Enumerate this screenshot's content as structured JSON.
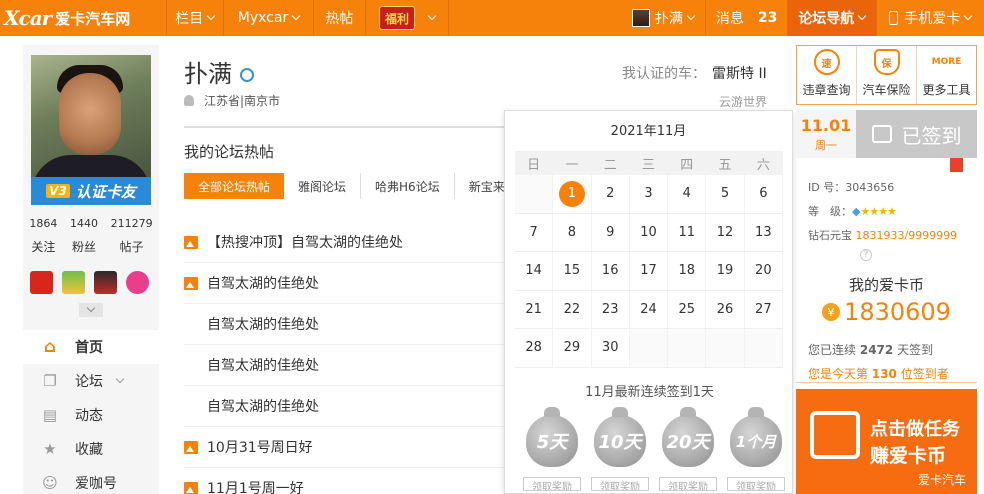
{
  "topnav": {
    "logo_mark": "Xcar",
    "logo_text": "爱卡汽车网",
    "column": "栏目",
    "myxcar": "Myxcar",
    "hot": "热帖",
    "fuli": "福利",
    "user": "扑满",
    "messages": "消息",
    "message_count": "23",
    "forum_nav": "论坛导航",
    "mobile": "手机爱卡"
  },
  "profile": {
    "badge_level": "V3",
    "badge_text": "认证卡友",
    "stats": [
      {
        "value": "1864",
        "label": "关注"
      },
      {
        "value": "1440",
        "label": "粉丝"
      },
      {
        "value": "211279",
        "label": "帖子"
      }
    ],
    "name": "扑满",
    "location": "江苏省|南京市",
    "car_label": "我认证的车：",
    "car": "雷斯特 II",
    "cloud": "云游世界"
  },
  "menu": [
    {
      "label": "首页",
      "icon": "home-icon"
    },
    {
      "label": "论坛",
      "icon": "forum-icon"
    },
    {
      "label": "动态",
      "icon": "feed-icon"
    },
    {
      "label": "收藏",
      "icon": "star-icon"
    },
    {
      "label": "爱咖号",
      "icon": "aika-icon"
    }
  ],
  "section": {
    "title": "我的论坛热帖",
    "tabs": [
      "全部论坛热帖",
      "雅阁论坛",
      "哈弗H6论坛",
      "新宝来"
    ]
  },
  "posts": [
    "【热搜冲顶】自驾太湖的佳绝处",
    "自驾太湖的佳绝处",
    "自驾太湖的佳绝处",
    "自驾太湖的佳绝处",
    "自驾太湖的佳绝处",
    "10月31号周日好",
    "11月1号周一好"
  ],
  "calendar": {
    "title": "2021年11月",
    "weekdays": [
      "日",
      "一",
      "二",
      "三",
      "四",
      "五",
      "六"
    ],
    "weeks": [
      [
        "",
        "1",
        "2",
        "3",
        "4",
        "5",
        "6"
      ],
      [
        "7",
        "8",
        "9",
        "10",
        "11",
        "12",
        "13"
      ],
      [
        "14",
        "15",
        "16",
        "17",
        "18",
        "19",
        "20"
      ],
      [
        "21",
        "22",
        "23",
        "24",
        "25",
        "26",
        "27"
      ],
      [
        "28",
        "29",
        "30",
        "",
        "",
        "",
        ""
      ]
    ],
    "today": "1",
    "streak_text": "11月最新连续签到1天",
    "rewards": [
      {
        "label": "5天",
        "button": "领取奖励"
      },
      {
        "label": "10天",
        "button": "领取奖励"
      },
      {
        "label": "20天",
        "button": "领取奖励"
      },
      {
        "label": "1个月",
        "button": "领取奖励"
      }
    ]
  },
  "tools": [
    {
      "label": "违章查询",
      "icon": "violation-icon"
    },
    {
      "label": "汽车保险",
      "icon": "insurance-icon"
    },
    {
      "label": "更多工具",
      "icon": "more-tools-icon",
      "mark": "MORE"
    }
  ],
  "signin": {
    "date": "11.01",
    "weekday": "周一",
    "status": "已签到"
  },
  "account": {
    "id_label": "ID 号：",
    "id": "3043656",
    "level_label": "等　级：",
    "level_stars": "★★★★",
    "diamond_label": "钻石元宝",
    "diamond_value": "1831933/9999999",
    "coins_title": "我的爱卡币",
    "coins": "1830609",
    "streak_pre": "您已连续",
    "streak_days": "2472",
    "streak_post": "天签到",
    "rank_pre": "您是今天第",
    "rank": "130",
    "rank_post": "位签到者"
  },
  "banner": {
    "line1": "点击做任务",
    "line2": "赚爱卡币",
    "footer": "爱卡汽车"
  },
  "colors": {
    "brand": "#f7820b",
    "nav_dark": "#e9640a",
    "signed_gray": "#c8c8c8"
  }
}
